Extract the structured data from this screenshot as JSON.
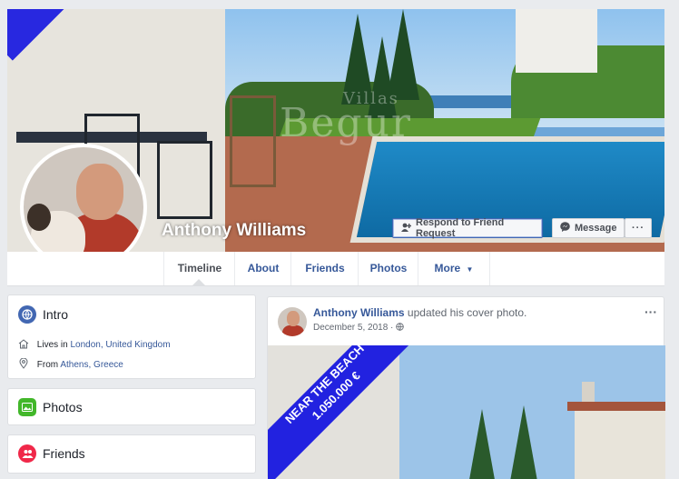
{
  "profile": {
    "name": "Anthony Williams"
  },
  "cover": {
    "watermark_small": "Villas",
    "watermark_big": "Begur"
  },
  "actions": {
    "respond_label": "Respond to Friend Request",
    "message_label": "Message",
    "more_label": "···"
  },
  "tabs": [
    {
      "label": "Timeline",
      "active": true
    },
    {
      "label": "About"
    },
    {
      "label": "Friends"
    },
    {
      "label": "Photos"
    },
    {
      "label": "More"
    }
  ],
  "intro": {
    "title": "Intro",
    "lives_prefix": "Lives in",
    "lives_location": "London, United Kingdom",
    "from_prefix": "From",
    "from_location": "Athens, Greece"
  },
  "photos_card": {
    "title": "Photos"
  },
  "friends_card": {
    "title": "Friends"
  },
  "post": {
    "author": "Anthony Williams",
    "action": "updated his cover photo.",
    "date": "December 5, 2018 · ",
    "menu": "···",
    "banner_line1": "NEAR THE BEACH",
    "banner_line2": "1.050.000 €"
  },
  "colors": {
    "link": "#365899",
    "ribbon": "#2222e0",
    "photos_icon": "#42b72a",
    "friends_icon": "#f02849",
    "intro_icon": "#4267b2"
  },
  "icons": [
    "globe-icon",
    "home-icon",
    "location-pin-icon",
    "photos-icon",
    "friends-icon",
    "add-friend-icon",
    "messenger-icon",
    "public-globe-icon",
    "dropdown-caret-icon"
  ]
}
